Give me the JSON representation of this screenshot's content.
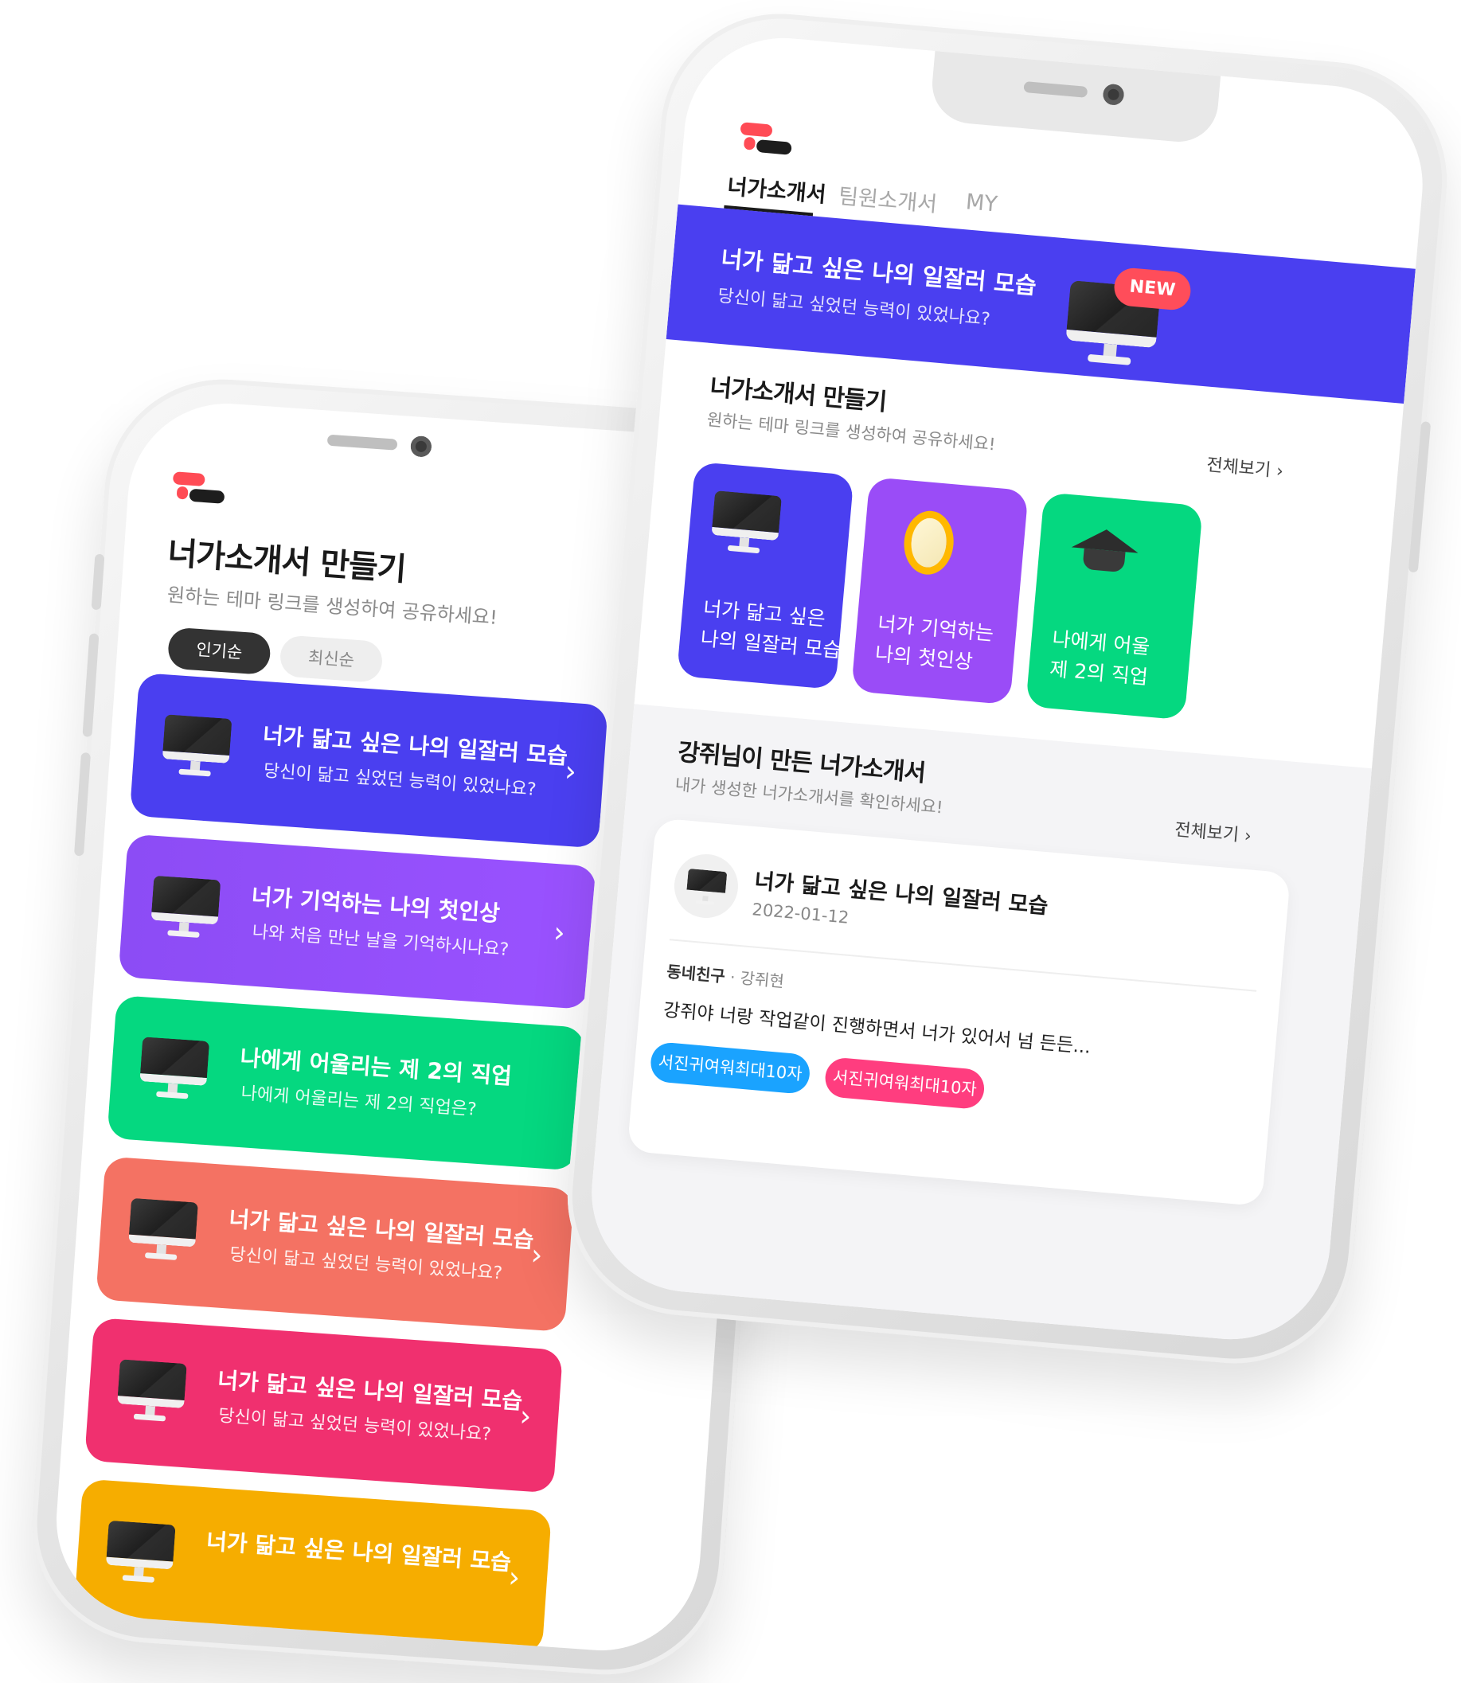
{
  "left_screen": {
    "title": "너가소개서 만들기",
    "subtitle": "원하는 테마 링크를 생성하여 공유하세요!",
    "sort_tabs": [
      {
        "label": "인기순",
        "active": true
      },
      {
        "label": "최신순",
        "active": false
      }
    ],
    "cards": [
      {
        "title": "너가 닮고 싶은 나의 일잘러 모습",
        "subtitle": "당신이 닮고 싶었던 능력이 있었나요?",
        "color": "#4a3ff0",
        "chevron": "›",
        "icon": "monitor-icon"
      },
      {
        "title": "너가 기억하는 나의 첫인상",
        "subtitle": "나와 처음 만난 날을 기억하시나요?",
        "color": "#8c4cf5",
        "chevron": "›",
        "icon": "monitor-icon"
      },
      {
        "title": "나에게 어울리는 제 2의 직업",
        "subtitle": "나에게 어울리는 제 2의 직업은?",
        "color": "#05d880",
        "chevron": "",
        "icon": "monitor-icon"
      },
      {
        "title": "너가 닮고 싶은 나의 일잘러 모습",
        "subtitle": "당신이 닮고 싶었던 능력이 있었나요?",
        "color": "#f47263",
        "chevron": "›",
        "icon": "monitor-icon"
      },
      {
        "title": "너가 닮고 싶은 나의 일잘러 모습",
        "subtitle": "당신이 닮고 싶었던 능력이 있었나요?",
        "color": "#f0306f",
        "chevron": "›",
        "icon": "monitor-icon"
      },
      {
        "title": "너가 닮고 싶은 나의 일잘러 모습",
        "subtitle": "",
        "color": "#f6ad00",
        "chevron": "›",
        "icon": "monitor-icon"
      }
    ]
  },
  "right_screen": {
    "tabs": [
      {
        "label": "너가소개서",
        "active": true
      },
      {
        "label": "팀원소개서",
        "active": false
      },
      {
        "label": "MY",
        "active": false
      }
    ],
    "banner": {
      "title": "너가 닮고 싶은 나의 일잘러 모습",
      "subtitle": "당신이 닮고 싶었던 능력이 있었나요?",
      "badge": "NEW",
      "color": "#4a3ff0"
    },
    "make_section": {
      "title": "너가소개서 만들기",
      "subtitle": "원하는 테마 링크를 생성하여 공유하세요!",
      "see_all": "전체보기 ›"
    },
    "theme_cards": [
      {
        "line1": "너가 닮고 싶은",
        "line2": "나의 일잘러 모습",
        "color": "#4a3ff0",
        "icon": "monitor-icon"
      },
      {
        "line1": "너가 기억하는",
        "line2": "나의 첫인상",
        "color": "#9a4cf7",
        "icon": "mirror-icon"
      },
      {
        "line1": "나에게 어울",
        "line2": "제 2의 직업",
        "color": "#05d880",
        "icon": "graduation-cap-icon"
      }
    ],
    "made_section": {
      "title": "강쥐님이 만든 너가소개서",
      "subtitle": "내가 생성한 너가소개서를 확인하세요!",
      "see_all": "전체보기 ›"
    },
    "post": {
      "title": "너가 닮고 싶은 나의 일잘러 모습",
      "date": "2022-01-12",
      "relation": "동네친구",
      "author": "· 강쥐현",
      "body": "강쥐야 너랑 작업같이 진행하면서 너가 있어서 넘 든든...",
      "tags": [
        {
          "label": "서진귀여워최대10자",
          "color": "#1aa3ff"
        },
        {
          "label": "서진귀여워최대10자",
          "color": "#ff3d7f"
        }
      ]
    }
  }
}
